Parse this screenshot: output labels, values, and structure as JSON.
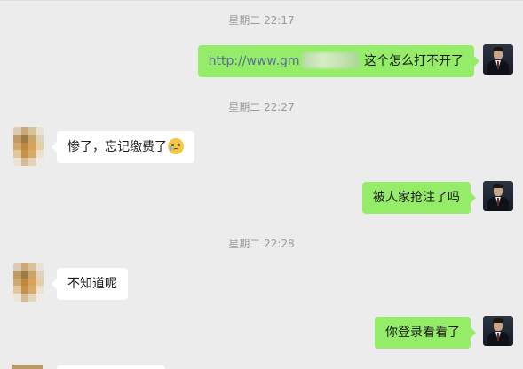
{
  "timestamps": {
    "t1": "星期二 22:17",
    "t2": "星期二 22:27",
    "t3": "星期二 22:28"
  },
  "messages": [
    {
      "sender": "self",
      "link_text": "http://www.gm",
      "link_redacted": true,
      "text": "这个怎么打不开了"
    },
    {
      "sender": "other",
      "text": "惨了，忘记缴费了",
      "emoji": "crying-face-icon"
    },
    {
      "sender": "self",
      "text": "被人家抢注了吗"
    },
    {
      "sender": "other",
      "text": "不知道呢"
    },
    {
      "sender": "self",
      "text": "你登录看看了"
    }
  ],
  "colors": {
    "background": "#ececec",
    "self_bubble": "#95ec69",
    "other_bubble": "#ffffff",
    "link": "#576b95",
    "timestamp": "#9a9a9a"
  },
  "icons": {
    "self_avatar": "man-in-suit-avatar",
    "other_avatar": "pixelated-avatar",
    "emoji": "crying-face-icon"
  }
}
